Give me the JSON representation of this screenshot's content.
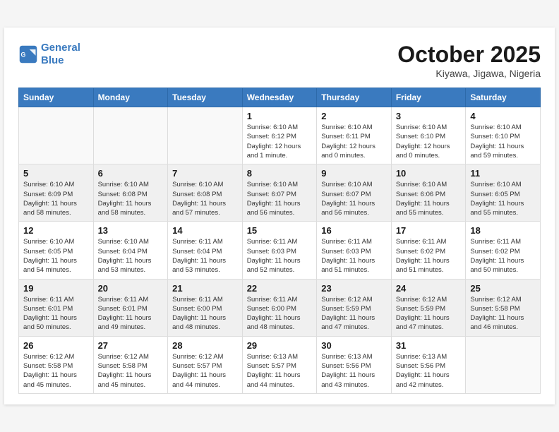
{
  "header": {
    "logo": {
      "line1": "General",
      "line2": "Blue"
    },
    "month_title": "October 2025",
    "location": "Kiyawa, Jigawa, Nigeria"
  },
  "weekdays": [
    "Sunday",
    "Monday",
    "Tuesday",
    "Wednesday",
    "Thursday",
    "Friday",
    "Saturday"
  ],
  "weeks": [
    {
      "shaded": false,
      "days": [
        {
          "num": "",
          "info": ""
        },
        {
          "num": "",
          "info": ""
        },
        {
          "num": "",
          "info": ""
        },
        {
          "num": "1",
          "info": "Sunrise: 6:10 AM\nSunset: 6:12 PM\nDaylight: 12 hours\nand 1 minute."
        },
        {
          "num": "2",
          "info": "Sunrise: 6:10 AM\nSunset: 6:11 PM\nDaylight: 12 hours\nand 0 minutes."
        },
        {
          "num": "3",
          "info": "Sunrise: 6:10 AM\nSunset: 6:10 PM\nDaylight: 12 hours\nand 0 minutes."
        },
        {
          "num": "4",
          "info": "Sunrise: 6:10 AM\nSunset: 6:10 PM\nDaylight: 11 hours\nand 59 minutes."
        }
      ]
    },
    {
      "shaded": true,
      "days": [
        {
          "num": "5",
          "info": "Sunrise: 6:10 AM\nSunset: 6:09 PM\nDaylight: 11 hours\nand 58 minutes."
        },
        {
          "num": "6",
          "info": "Sunrise: 6:10 AM\nSunset: 6:08 PM\nDaylight: 11 hours\nand 58 minutes."
        },
        {
          "num": "7",
          "info": "Sunrise: 6:10 AM\nSunset: 6:08 PM\nDaylight: 11 hours\nand 57 minutes."
        },
        {
          "num": "8",
          "info": "Sunrise: 6:10 AM\nSunset: 6:07 PM\nDaylight: 11 hours\nand 56 minutes."
        },
        {
          "num": "9",
          "info": "Sunrise: 6:10 AM\nSunset: 6:07 PM\nDaylight: 11 hours\nand 56 minutes."
        },
        {
          "num": "10",
          "info": "Sunrise: 6:10 AM\nSunset: 6:06 PM\nDaylight: 11 hours\nand 55 minutes."
        },
        {
          "num": "11",
          "info": "Sunrise: 6:10 AM\nSunset: 6:05 PM\nDaylight: 11 hours\nand 55 minutes."
        }
      ]
    },
    {
      "shaded": false,
      "days": [
        {
          "num": "12",
          "info": "Sunrise: 6:10 AM\nSunset: 6:05 PM\nDaylight: 11 hours\nand 54 minutes."
        },
        {
          "num": "13",
          "info": "Sunrise: 6:10 AM\nSunset: 6:04 PM\nDaylight: 11 hours\nand 53 minutes."
        },
        {
          "num": "14",
          "info": "Sunrise: 6:11 AM\nSunset: 6:04 PM\nDaylight: 11 hours\nand 53 minutes."
        },
        {
          "num": "15",
          "info": "Sunrise: 6:11 AM\nSunset: 6:03 PM\nDaylight: 11 hours\nand 52 minutes."
        },
        {
          "num": "16",
          "info": "Sunrise: 6:11 AM\nSunset: 6:03 PM\nDaylight: 11 hours\nand 51 minutes."
        },
        {
          "num": "17",
          "info": "Sunrise: 6:11 AM\nSunset: 6:02 PM\nDaylight: 11 hours\nand 51 minutes."
        },
        {
          "num": "18",
          "info": "Sunrise: 6:11 AM\nSunset: 6:02 PM\nDaylight: 11 hours\nand 50 minutes."
        }
      ]
    },
    {
      "shaded": true,
      "days": [
        {
          "num": "19",
          "info": "Sunrise: 6:11 AM\nSunset: 6:01 PM\nDaylight: 11 hours\nand 50 minutes."
        },
        {
          "num": "20",
          "info": "Sunrise: 6:11 AM\nSunset: 6:01 PM\nDaylight: 11 hours\nand 49 minutes."
        },
        {
          "num": "21",
          "info": "Sunrise: 6:11 AM\nSunset: 6:00 PM\nDaylight: 11 hours\nand 48 minutes."
        },
        {
          "num": "22",
          "info": "Sunrise: 6:11 AM\nSunset: 6:00 PM\nDaylight: 11 hours\nand 48 minutes."
        },
        {
          "num": "23",
          "info": "Sunrise: 6:12 AM\nSunset: 5:59 PM\nDaylight: 11 hours\nand 47 minutes."
        },
        {
          "num": "24",
          "info": "Sunrise: 6:12 AM\nSunset: 5:59 PM\nDaylight: 11 hours\nand 47 minutes."
        },
        {
          "num": "25",
          "info": "Sunrise: 6:12 AM\nSunset: 5:58 PM\nDaylight: 11 hours\nand 46 minutes."
        }
      ]
    },
    {
      "shaded": false,
      "days": [
        {
          "num": "26",
          "info": "Sunrise: 6:12 AM\nSunset: 5:58 PM\nDaylight: 11 hours\nand 45 minutes."
        },
        {
          "num": "27",
          "info": "Sunrise: 6:12 AM\nSunset: 5:58 PM\nDaylight: 11 hours\nand 45 minutes."
        },
        {
          "num": "28",
          "info": "Sunrise: 6:12 AM\nSunset: 5:57 PM\nDaylight: 11 hours\nand 44 minutes."
        },
        {
          "num": "29",
          "info": "Sunrise: 6:13 AM\nSunset: 5:57 PM\nDaylight: 11 hours\nand 44 minutes."
        },
        {
          "num": "30",
          "info": "Sunrise: 6:13 AM\nSunset: 5:56 PM\nDaylight: 11 hours\nand 43 minutes."
        },
        {
          "num": "31",
          "info": "Sunrise: 6:13 AM\nSunset: 5:56 PM\nDaylight: 11 hours\nand 42 minutes."
        },
        {
          "num": "",
          "info": ""
        }
      ]
    }
  ]
}
